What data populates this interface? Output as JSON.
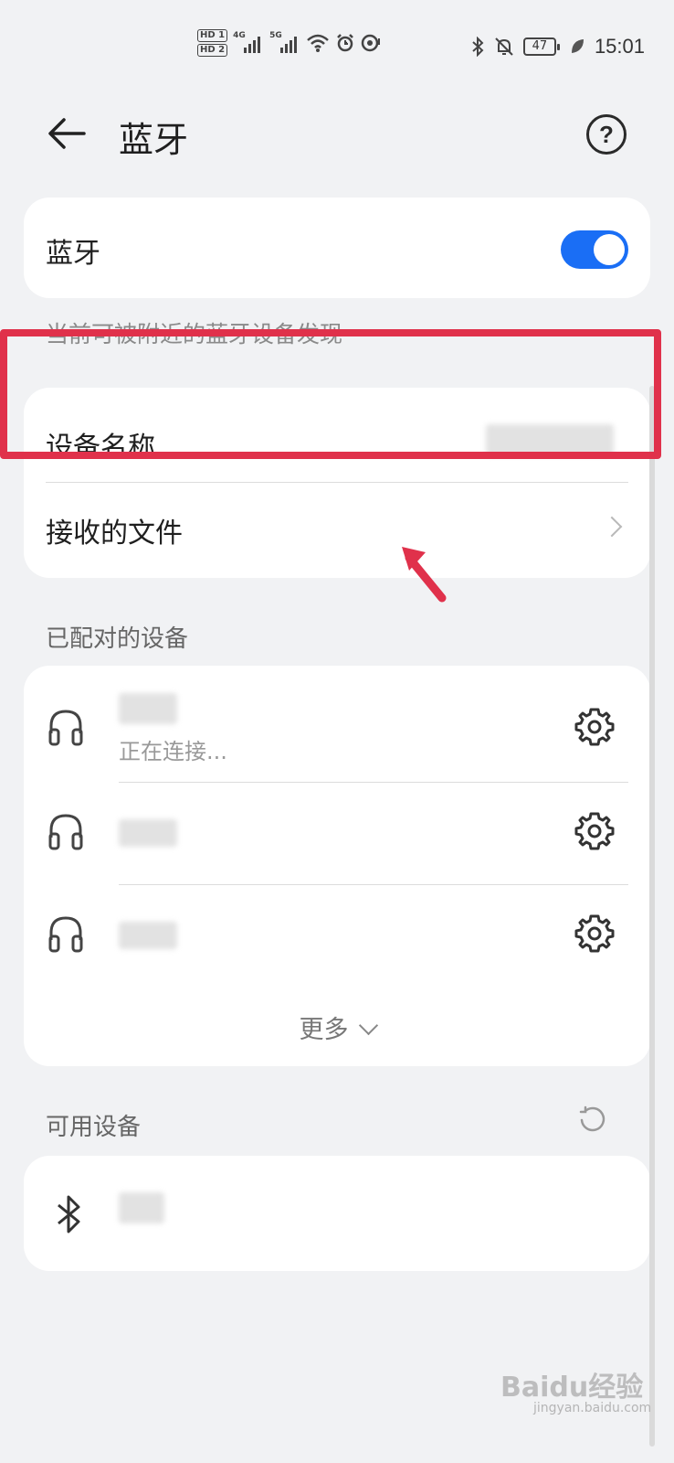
{
  "status_bar": {
    "hd_tag_1": "HD 1",
    "hd_tag_2": "HD 2",
    "network_gen_1": "4G",
    "network_gen_2": "5G",
    "battery_level": "47",
    "time": "15:01",
    "icons": [
      "hd-icon",
      "signal-4g-icon",
      "signal-5g-icon",
      "wifi-icon",
      "alarm-icon",
      "location-icon",
      "bluetooth-icon",
      "mute-icon",
      "battery-icon",
      "leaf-icon"
    ]
  },
  "header": {
    "title": "蓝牙",
    "back_icon": "back-arrow-icon",
    "help_icon": "help-icon",
    "help_glyph": "?"
  },
  "bluetooth_card": {
    "label": "蓝牙",
    "toggle_on": true,
    "accent_color": "#1a6ef5"
  },
  "discoverable_note": "当前可被附近的蓝牙设备发现",
  "info_card": {
    "device_name_label": "设备名称",
    "received_files_label": "接收的文件"
  },
  "paired_devices": {
    "section_title": "已配对的设备",
    "items": [
      {
        "icon": "headphones-icon",
        "status": "正在连接..."
      },
      {
        "icon": "headphones-icon",
        "status": ""
      },
      {
        "icon": "headphones-icon",
        "status": ""
      }
    ],
    "more_label": "更多"
  },
  "available_devices": {
    "section_title": "可用设备",
    "refresh_icon": "refresh-icon",
    "items": [
      {
        "icon": "bluetooth-icon"
      }
    ]
  },
  "annotation": {
    "highlight_color": "#e0314b"
  },
  "watermark": {
    "text": "Baidu经验",
    "sub": "jingyan.baidu.com"
  }
}
